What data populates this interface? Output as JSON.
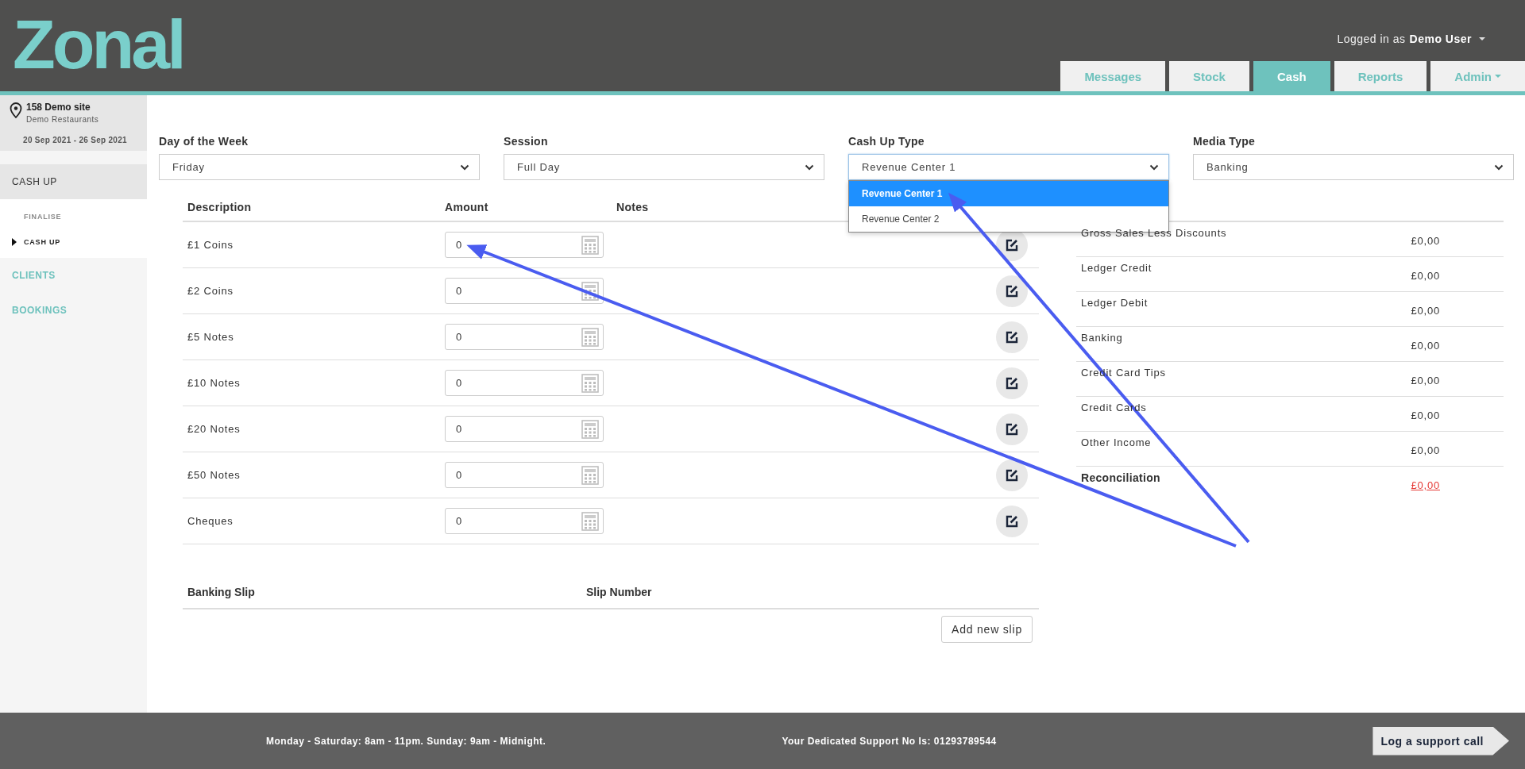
{
  "header": {
    "logo": "Zonal",
    "user": {
      "prefix": "Logged in as",
      "name": "Demo User"
    },
    "tabs": [
      {
        "label": "Messages",
        "selected": false,
        "has_menu": false
      },
      {
        "label": "Stock",
        "selected": false,
        "has_menu": false
      },
      {
        "label": "Cash",
        "selected": true,
        "has_menu": false
      },
      {
        "label": "Reports",
        "selected": false,
        "has_menu": false
      },
      {
        "label": "Admin",
        "selected": false,
        "has_menu": true
      }
    ]
  },
  "site": {
    "name": "158 Demo site",
    "company": "Demo Restaurants",
    "dates": "20 Sep 2021 - 26 Sep 2021"
  },
  "sidebar": {
    "items": [
      {
        "label": "CASH UP",
        "expanded": true,
        "children": [
          {
            "label": "FINALISE",
            "selected": false
          },
          {
            "label": "CASH UP",
            "selected": true
          }
        ]
      },
      {
        "label": "CLIENTS",
        "expanded": false
      },
      {
        "label": "BOOKINGS",
        "expanded": false
      }
    ]
  },
  "filters": [
    {
      "label": "Day of the Week",
      "value": "Friday",
      "open": false
    },
    {
      "label": "Session",
      "value": "Full Day",
      "open": false
    },
    {
      "label": "Cash Up Type",
      "value": "Revenue Center 1",
      "open": true,
      "options": [
        {
          "label": "Revenue Center 1",
          "selected": true
        },
        {
          "label": "Revenue Center 2",
          "selected": false
        }
      ]
    },
    {
      "label": "Media Type",
      "value": "Banking",
      "open": false
    }
  ],
  "cash_table": {
    "columns": [
      "Description",
      "Amount",
      "Notes"
    ],
    "rows": [
      {
        "description": "£1 Coins",
        "amount": "0"
      },
      {
        "description": "£2 Coins",
        "amount": "0"
      },
      {
        "description": "£5 Notes",
        "amount": "0"
      },
      {
        "description": "£10 Notes",
        "amount": "0"
      },
      {
        "description": "£20 Notes",
        "amount": "0"
      },
      {
        "description": "£50 Notes",
        "amount": "0"
      },
      {
        "description": "Cheques",
        "amount": "0"
      }
    ]
  },
  "summary": {
    "rows": [
      {
        "label": "Gross Sales Less Discounts",
        "value": "£0,00",
        "kind": "line"
      },
      {
        "label": "Ledger Credit",
        "value": "£0,00",
        "kind": "line"
      },
      {
        "label": "Ledger Debit",
        "value": "£0,00",
        "kind": "line"
      },
      {
        "label": "Banking",
        "value": "£0,00",
        "kind": "line"
      },
      {
        "label": "Credit Card Tips",
        "value": "£0,00",
        "kind": "line"
      },
      {
        "label": "Credit Cards",
        "value": "£0,00",
        "kind": "line"
      },
      {
        "label": "Other Income",
        "value": "£0,00",
        "kind": "line"
      },
      {
        "label": "Reconciliation",
        "value": "£0,00",
        "kind": "total"
      }
    ]
  },
  "slips": {
    "columns": [
      "Banking Slip",
      "Slip Number"
    ],
    "add_button": "Add new slip"
  },
  "footer": {
    "hours": "Monday - Saturday: 8am - 11pm. Sunday: 9am - Midnight.",
    "support": "Your Dedicated Support No Is: 01293789544",
    "button": "Log a support call"
  }
}
